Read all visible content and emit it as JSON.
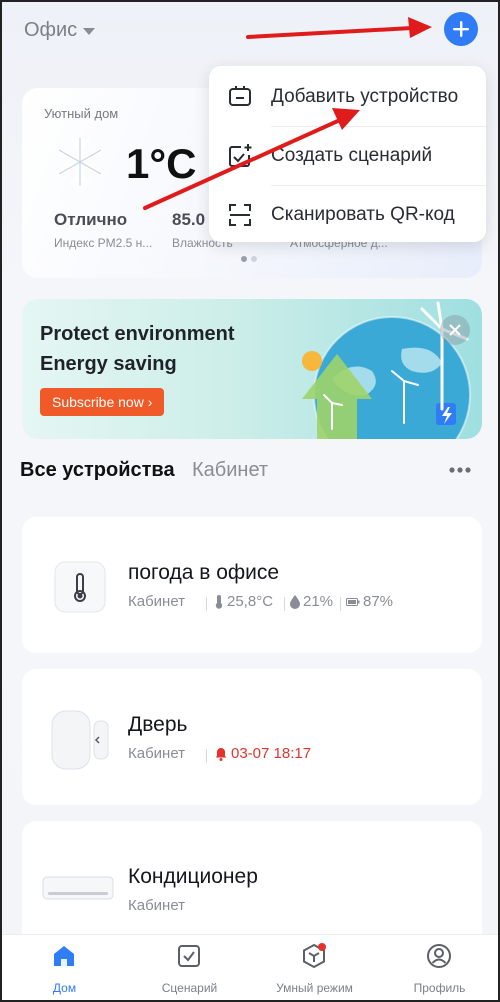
{
  "header": {
    "home_name": "Офис",
    "add_icon": "plus-icon"
  },
  "weather": {
    "title": "Уютный дом",
    "icon": "snowflake-icon",
    "temperature": "1°C",
    "metrics": [
      {
        "value": "Отлично",
        "label": "Индекс PM2.5 н..."
      },
      {
        "value": "85.0",
        "label": "Влажность"
      },
      {
        "value": "",
        "label": "Атмосферное д..."
      }
    ],
    "pages": 2,
    "active_page": 1
  },
  "menu": {
    "items": [
      {
        "label": "Добавить устройство",
        "icon": "add-device-icon"
      },
      {
        "label": "Создать сценарий",
        "icon": "create-scene-icon"
      },
      {
        "label": "Сканировать QR-код",
        "icon": "scan-qr-icon"
      }
    ]
  },
  "banner": {
    "line1": "Protect environment",
    "line2": "Energy saving",
    "button": "Subscribe now ›",
    "colors": {
      "accent": "#f05a28"
    }
  },
  "tabs": {
    "all": "Все устройства",
    "cabinet": "Кабинет",
    "more_icon": "more-dots-icon"
  },
  "devices": [
    {
      "name": "погода в офисе",
      "room": "Кабинет",
      "icon": "thermometer-sensor-icon",
      "temperature": "25,8°C",
      "humidity": "21%",
      "battery": "87%"
    },
    {
      "name": "Дверь",
      "room": "Кабинет",
      "icon": "door-sensor-icon",
      "alarm": "03-07 18:17",
      "alarm_color": "#e5322d"
    },
    {
      "name": "Кондиционер",
      "room": "Кабинет",
      "icon": "air-conditioner-icon"
    }
  ],
  "nav": [
    {
      "label": "Дом",
      "icon": "home-icon",
      "active": true
    },
    {
      "label": "Сценарий",
      "icon": "scenario-icon",
      "active": false
    },
    {
      "label": "Умный режим",
      "icon": "smart-mode-icon",
      "active": false,
      "badge": true
    },
    {
      "label": "Профиль",
      "icon": "profile-icon",
      "active": false
    }
  ],
  "colors": {
    "primary": "#2f7cf6",
    "annotation": "#e01b1b"
  }
}
